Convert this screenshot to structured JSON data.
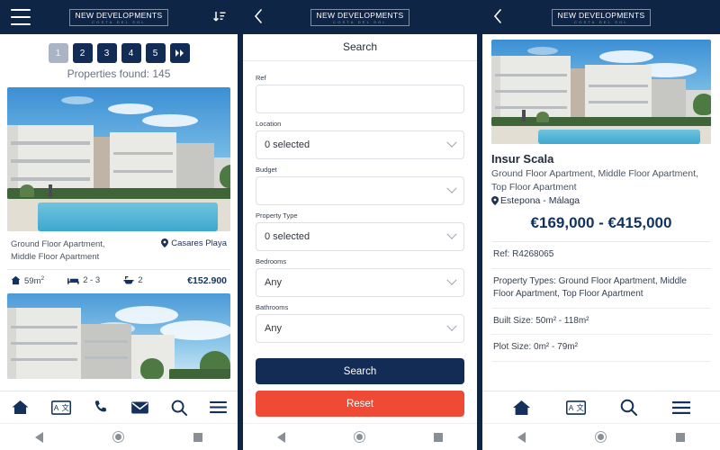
{
  "brand": {
    "logo_line1": "NEW DEVELOPMENTS",
    "logo_line2": "COSTA DEL SOL",
    "navy": "#122c55",
    "accent_red": "#ee4a36"
  },
  "panel_listing": {
    "header": {
      "menu_icon": "hamburger-icon",
      "sort_icon": "sort-descending-icon"
    },
    "pagination": {
      "pages": [
        "1",
        "2",
        "3",
        "4",
        "5"
      ],
      "active_page": "1",
      "next_label": "▶▶"
    },
    "results_text": "Properties found: 145",
    "cards": [
      {
        "types": "Ground Floor Apartment, Middle Floor Apartment",
        "location": "Casares Playa",
        "area": "59m",
        "area_sup": "2",
        "bedrooms": "2 - 3",
        "bathrooms": "2",
        "price": "€152.900"
      }
    ],
    "bottom_nav": [
      {
        "name": "home-icon",
        "label": "Home"
      },
      {
        "name": "translate-icon",
        "label": "Language"
      },
      {
        "name": "phone-icon",
        "label": "Call"
      },
      {
        "name": "envelope-icon",
        "label": "Email"
      },
      {
        "name": "search-icon",
        "label": "Search"
      },
      {
        "name": "hamburger-icon",
        "label": "Menu"
      }
    ]
  },
  "panel_search": {
    "header": {
      "back_icon": "chevron-left-icon"
    },
    "title": "Search",
    "fields": [
      {
        "label": "Ref",
        "value": "",
        "type": "text"
      },
      {
        "label": "Location",
        "value": "0 selected",
        "type": "select"
      },
      {
        "label": "Budget",
        "value": "",
        "type": "select"
      },
      {
        "label": "Property Type",
        "value": "0 selected",
        "type": "select"
      },
      {
        "label": "Bedrooms",
        "value": "Any",
        "type": "select"
      },
      {
        "label": "Bathrooms",
        "value": "Any",
        "type": "select"
      }
    ],
    "search_button": "Search",
    "reset_button": "Reset"
  },
  "panel_detail": {
    "header": {
      "back_icon": "chevron-left-icon"
    },
    "title": "Insur Scala",
    "types": "Ground Floor Apartment, Middle Floor Apartment, Top Floor Apartment",
    "location": "Estepona - Málaga",
    "price_range": "€169,000 - €415,000",
    "rows": [
      "Ref: R4268065",
      "Property Types: Ground Floor Apartment, Middle Floor Apartment, Top Floor Apartment",
      "Built Size: 50m² - 118m²",
      "Plot Size: 0m² - 79m²"
    ],
    "bottom_nav": [
      {
        "name": "home-icon",
        "label": "Home"
      },
      {
        "name": "translate-icon",
        "label": "Language"
      },
      {
        "name": "search-icon",
        "label": "Search"
      },
      {
        "name": "hamburger-icon",
        "label": "Menu"
      }
    ]
  },
  "system_bar": {
    "back": "back-triangle",
    "home": "home-circle",
    "recents": "recents-square"
  }
}
